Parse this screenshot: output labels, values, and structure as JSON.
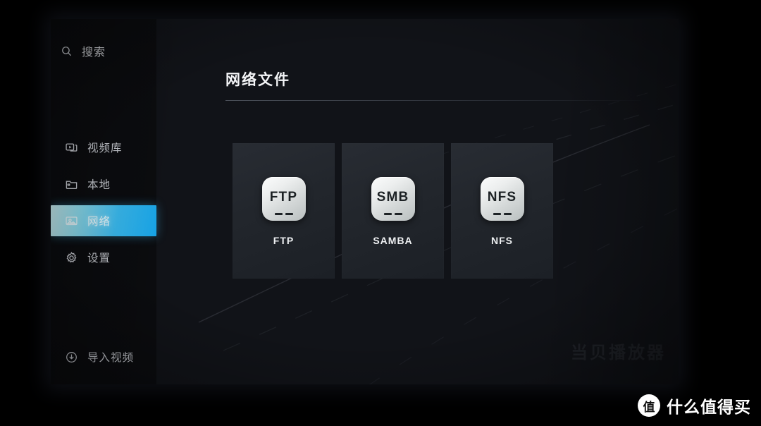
{
  "app": {
    "name": "当贝播放器",
    "watermark": "当贝播放器"
  },
  "sidebar": {
    "search": {
      "icon": "search-icon",
      "label": "搜索"
    },
    "items": [
      {
        "id": "video-library",
        "icon": "video-library-icon",
        "label": "视频库",
        "active": false
      },
      {
        "id": "local",
        "icon": "folder-icon",
        "label": "本地",
        "active": false
      },
      {
        "id": "network",
        "icon": "network-screen-icon",
        "label": "网络",
        "active": true
      },
      {
        "id": "settings",
        "icon": "gear-icon",
        "label": "设置",
        "active": false
      }
    ],
    "footer": {
      "icon": "import-download-icon",
      "label": "导入视频"
    }
  },
  "main": {
    "title": "网络文件",
    "cards": [
      {
        "id": "ftp",
        "abbr": "FTP",
        "caption": "FTP"
      },
      {
        "id": "samba",
        "abbr": "SMB",
        "caption": "SAMBA"
      },
      {
        "id": "nfs",
        "abbr": "NFS",
        "caption": "NFS"
      }
    ]
  },
  "overlay": {
    "badge_mark": "值",
    "badge_text": "什么值得买"
  },
  "colors": {
    "accent_start": "#cdf2f6",
    "accent_end": "#17a6ea",
    "screen_bg": "#0a0b0e",
    "panel_bg": "#111318",
    "card_bg": "#22262c",
    "tile_light": "#fbfcfc",
    "text_primary": "#f3f4f6"
  }
}
